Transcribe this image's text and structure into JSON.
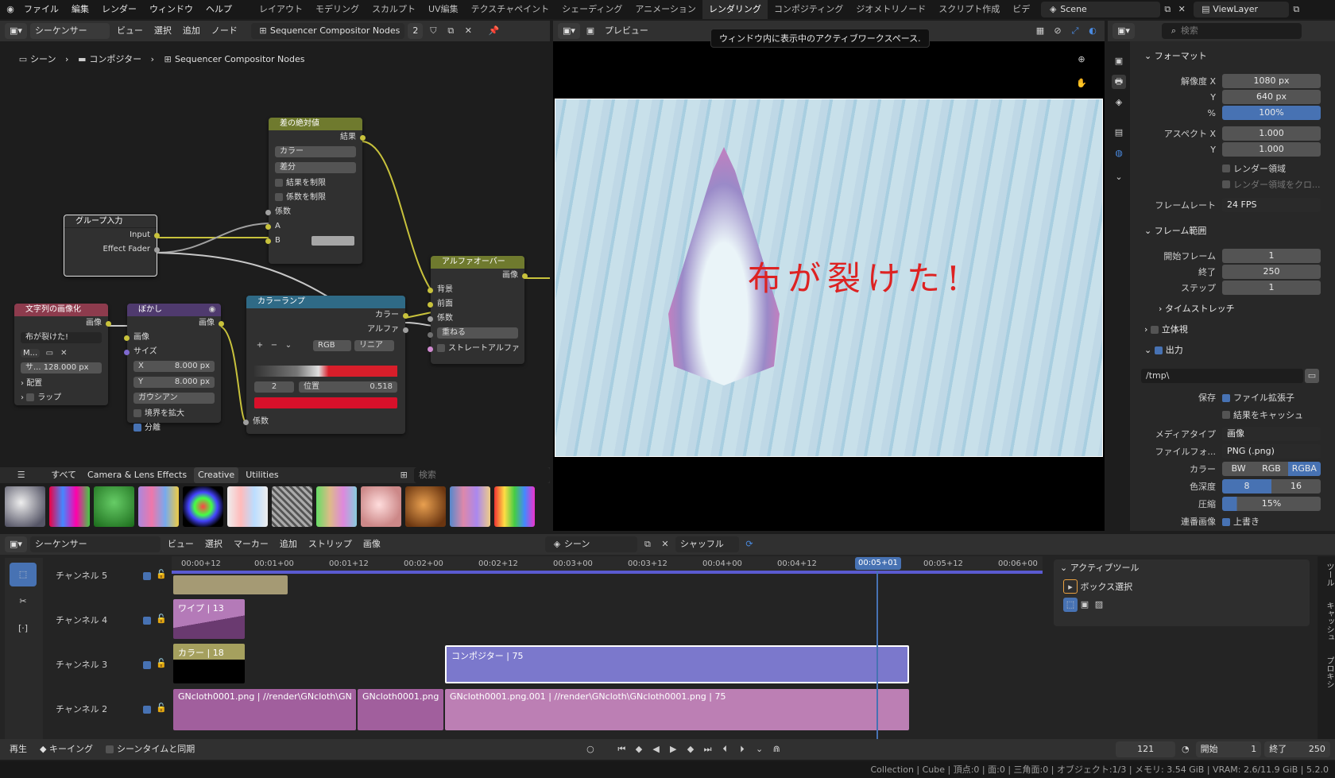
{
  "topbar": {
    "menus": [
      "ファイル",
      "編集",
      "レンダー",
      "ウィンドウ",
      "ヘルプ"
    ],
    "workspaces": [
      "レイアウト",
      "モデリング",
      "スカルプト",
      "UV編集",
      "テクスチャペイント",
      "シェーディング",
      "アニメーション",
      "レンダリング",
      "コンポジティング",
      "ジオメトリノード",
      "スクリプト作成",
      "ビデ"
    ],
    "active_workspace": "レンダリング",
    "scene": "Scene",
    "view_layer": "ViewLayer"
  },
  "tooltip": "ウィンドウ内に表示中のアクティブワークスペース.",
  "node_editor": {
    "editor": "シーケンサー",
    "menus": [
      "ビュー",
      "選択",
      "追加",
      "ノード"
    ],
    "tree_name": "Sequencer Compositor Nodes",
    "users": "2",
    "breadcrumb": [
      "シーン",
      "コンポジター",
      "Sequencer Compositor Nodes"
    ],
    "nodes": {
      "absdiff": {
        "title": "差の絶対値",
        "out": "結果",
        "type": "カラー",
        "mode": "差分",
        "clamp_result": "結果を制限",
        "clamp_factor": "係数を制限",
        "in_fac": "係数",
        "in_a": "A",
        "in_b": "B"
      },
      "group_input": {
        "title": "グループ入力",
        "out1": "Input",
        "out2": "Effect Fader"
      },
      "alpha_over": {
        "title": "アルファオーバー",
        "out": "画像",
        "in_bg": "背景",
        "in_fg": "前面",
        "in_fac": "係数",
        "mode": "重ねる",
        "straight": "ストレートアルファ"
      },
      "text": {
        "title": "文字列の画像化",
        "out": "画像",
        "string": "布が裂けた!",
        "font": "M...",
        "size": "サ... 128.000 px",
        "align": "配置",
        "wrap": "ラップ"
      },
      "blur": {
        "title": "ぼかし",
        "out": "画像",
        "in_img": "画像",
        "size": "サイズ",
        "x": "8.000 px",
        "y": "8.000 px",
        "filter": "ガウシアン",
        "extend": "境界を拡大",
        "separable": "分離"
      },
      "ramp": {
        "title": "カラーランプ",
        "out_color": "カラー",
        "out_alpha": "アルファ",
        "mode": "RGB",
        "interp": "リニア",
        "index": "2",
        "pos_label": "位置",
        "pos": "0.518",
        "in_fac": "係数"
      }
    },
    "asset_tabs": [
      "すべて",
      "Camera & Lens Effects",
      "Creative",
      "Utilities"
    ],
    "asset_active": "Creative",
    "search_placeholder": "検索"
  },
  "preview": {
    "label": "プレビュー",
    "overlay_text": "布が裂けた!"
  },
  "properties": {
    "search_placeholder": "検索",
    "format_section": "フォーマット",
    "res_x_label": "解像度 X",
    "res_x": "1080 px",
    "res_y_label": "Y",
    "res_y": "640 px",
    "res_pct_label": "%",
    "res_pct": "100%",
    "aspect_x_label": "アスペクト X",
    "aspect_x": "1.000",
    "aspect_y_label": "Y",
    "aspect_y": "1.000",
    "render_region": "レンダー領域",
    "crop_region": "レンダー領域をクロ...",
    "fps_label": "フレームレート",
    "fps": "24 FPS",
    "frame_section": "フレーム範囲",
    "start_label": "開始フレーム",
    "start": "1",
    "end_label": "終了",
    "end": "250",
    "step_label": "ステップ",
    "step": "1",
    "timestretch": "タイムストレッチ",
    "stereo": "立体視",
    "output_section": "出力",
    "output_path": "/tmp\\",
    "save_label": "保存",
    "file_ext": "ファイル拡張子",
    "cache": "結果をキャッシュ",
    "media_label": "メディアタイプ",
    "media": "画像",
    "format_label": "ファイルフォ...",
    "format": "PNG (.png)",
    "color_label": "カラー",
    "color_opts": [
      "BW",
      "RGB",
      "RGBA"
    ],
    "depth_label": "色深度",
    "depth_opts": [
      "8",
      "16"
    ],
    "compress_label": "圧縮",
    "compress": "15%",
    "seq_label": "連番画像",
    "overwrite": "上書き"
  },
  "sequencer": {
    "editor": "シーケンサー",
    "menus": [
      "ビュー",
      "選択",
      "マーカー",
      "追加",
      "ストリップ",
      "画像"
    ],
    "scene": "シーン",
    "mode": "シャッフル",
    "ticks": [
      "00:00+12",
      "00:01+00",
      "00:01+12",
      "00:02+00",
      "00:02+12",
      "00:03+00",
      "00:03+12",
      "00:04+00",
      "00:04+12",
      "00:05+01",
      "00:05+12",
      "00:06+00"
    ],
    "current": "00:05+01",
    "channels": [
      "チャンネル 5",
      "チャンネル 4",
      "チャンネル 3",
      "チャンネル 2"
    ],
    "strips": {
      "wipe": "ワイプ | 13",
      "color": "カラー | 18",
      "compositor": "コンポジター | 75",
      "img1": "GNcloth0001.png | //render\\GNcloth\\GN",
      "img2": "GNcloth0001.png",
      "img3": "GNcloth0001.png.001 | //render\\GNcloth\\GNcloth0001.png | 75"
    },
    "active_tool_title": "アクティブツール",
    "active_tool": "ボックス選択",
    "side_tabs": [
      "ツール",
      "キャッシュ",
      "プロキシ"
    ]
  },
  "playback": {
    "play": "再生",
    "keying": "キーイング",
    "sync": "シーンタイムと同期",
    "frame": "121",
    "start_label": "開始",
    "start": "1",
    "end_label": "終了",
    "end": "250"
  },
  "status": "Collection | Cube | 頂点:0 | 面:0 | 三角面:0 | オブジェクト:1/3 | メモリ: 3.54 GiB | VRAM: 2.6/11.9 GiB | 5.2.0"
}
